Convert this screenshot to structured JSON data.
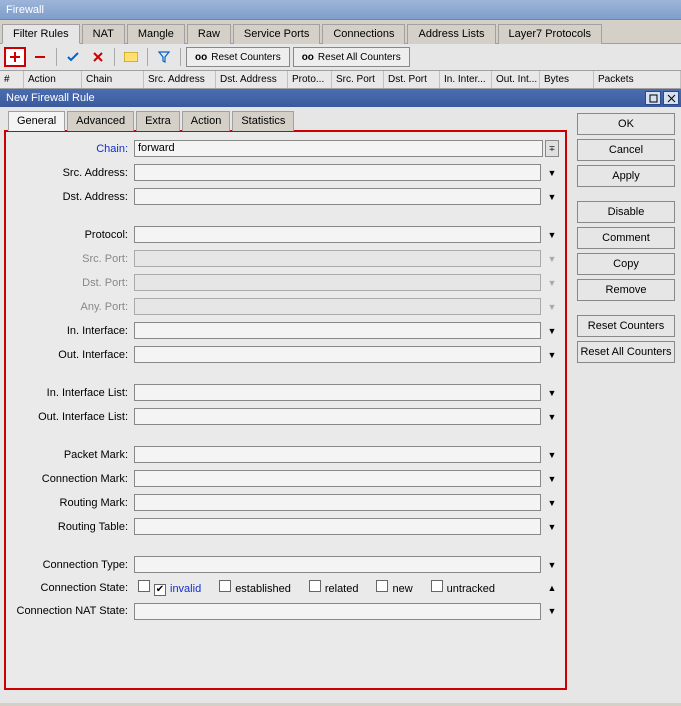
{
  "window_title": "Firewall",
  "main_tabs": [
    "Filter Rules",
    "NAT",
    "Mangle",
    "Raw",
    "Service Ports",
    "Connections",
    "Address Lists",
    "Layer7 Protocols"
  ],
  "toolbar": {
    "reset_counters": "Reset Counters",
    "reset_all_counters": "Reset All Counters",
    "oo": "oo"
  },
  "columns": [
    "#",
    "Action",
    "Chain",
    "Src. Address",
    "Dst. Address",
    "Proto...",
    "Src. Port",
    "Dst. Port",
    "In. Inter...",
    "Out. Int...",
    "Bytes",
    "Packets"
  ],
  "dialog_title": "New Firewall Rule",
  "form_tabs": [
    "General",
    "Advanced",
    "Extra",
    "Action",
    "Statistics"
  ],
  "fields": {
    "chain": {
      "label": "Chain:",
      "value": "forward"
    },
    "src_addr": {
      "label": "Src. Address:"
    },
    "dst_addr": {
      "label": "Dst. Address:"
    },
    "protocol": {
      "label": "Protocol:"
    },
    "src_port": {
      "label": "Src. Port:"
    },
    "dst_port": {
      "label": "Dst. Port:"
    },
    "any_port": {
      "label": "Any. Port:"
    },
    "in_if": {
      "label": "In. Interface:"
    },
    "out_if": {
      "label": "Out. Interface:"
    },
    "in_if_list": {
      "label": "In. Interface List:"
    },
    "out_if_list": {
      "label": "Out. Interface List:"
    },
    "packet_mark": {
      "label": "Packet Mark:"
    },
    "conn_mark": {
      "label": "Connection Mark:"
    },
    "routing_mark": {
      "label": "Routing Mark:"
    },
    "routing_table": {
      "label": "Routing Table:"
    },
    "conn_type": {
      "label": "Connection Type:"
    },
    "conn_state": {
      "label": "Connection State:"
    },
    "conn_nat_state": {
      "label": "Connection NAT State:"
    }
  },
  "conn_state_opts": {
    "invalid": "invalid",
    "established": "established",
    "related": "related",
    "new": "new",
    "untracked": "untracked"
  },
  "side_buttons": [
    "OK",
    "Cancel",
    "Apply",
    "Disable",
    "Comment",
    "Copy",
    "Remove",
    "Reset Counters",
    "Reset All Counters"
  ]
}
